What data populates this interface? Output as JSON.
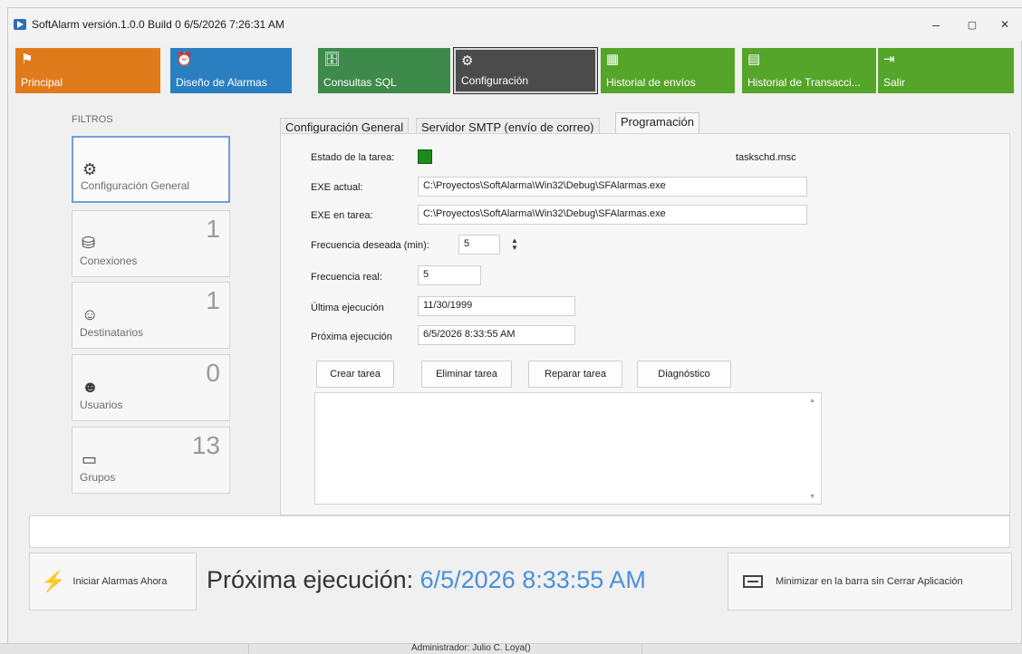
{
  "window": {
    "title": "SoftAlarm  versión.1.0.0 Build 0 6/5/2026 7:26:31 AM",
    "minimize": "–",
    "maximize": "▢",
    "close": "✕"
  },
  "ribbon": {
    "tiles": [
      {
        "label": "Principal",
        "icon": "flag-icon",
        "color": "#e07b1c"
      },
      {
        "label": "Diseño de Alarmas",
        "icon": "alarm-clock-icon",
        "color": "#2a7fc0"
      },
      {
        "label": "Consultas SQL",
        "icon": "database-icon",
        "color": "#3d8a4a"
      },
      {
        "label": "Configuración",
        "icon": "gear-icon",
        "color": "#4b4b4b"
      },
      {
        "label": "Historial de envíos",
        "icon": "calendar-icon",
        "color": "#54a52a"
      },
      {
        "label": "Historial de Transacci...",
        "icon": "server-icon",
        "color": "#54a52a"
      },
      {
        "label": "Salir",
        "icon": "exit-icon",
        "color": "#54a52a"
      }
    ]
  },
  "filters": {
    "heading": "FILTROS",
    "cards": [
      {
        "label": "Configuración General",
        "count": "",
        "icon": "gear-icon"
      },
      {
        "label": "Conexiones",
        "count": "1",
        "icon": "connection-icon"
      },
      {
        "label": "Destinatarios",
        "count": "1",
        "icon": "user-gear-icon"
      },
      {
        "label": "Usuarios",
        "count": "0",
        "icon": "users-icon"
      },
      {
        "label": "Grupos",
        "count": "13",
        "icon": "group-folder-icon"
      }
    ]
  },
  "tabs": [
    "Configuración General",
    "Servidor SMTP (envío de correo)",
    "Programación"
  ],
  "programacion": {
    "estado_label": "Estado de la tarea:",
    "estado_color": "#1c8a1c",
    "taskschd": "taskschd.msc",
    "exe_actual_label": "EXE actual:",
    "exe_actual": "C:\\Proyectos\\SoftAlarma\\Win32\\Debug\\SFAlarmas.exe",
    "exe_tarea_label": "EXE en tarea:",
    "exe_tarea": "C:\\Proyectos\\SoftAlarma\\Win32\\Debug\\SFAlarmas.exe",
    "freq_deseada_label": "Frecuencia deseada (min):",
    "freq_deseada": "5",
    "freq_real_label": "Frecuencia real:",
    "freq_real": "5",
    "ultima_label": "Última ejecución",
    "ultima": "11/30/1999",
    "proxima_label": "Próxima ejecución",
    "proxima": "6/5/2026 8:33:55 AM",
    "buttons": {
      "crear": "Crear tarea",
      "eliminar": "Eliminar tarea",
      "reparar": "Reparar tarea",
      "diagnostico": "Diagnóstico"
    }
  },
  "footer": {
    "iniciar_label": "Iniciar Alarmas Ahora",
    "next_label": "Próxima ejecución: ",
    "next_value": "6/5/2026 8:33:55 AM",
    "minimizar_label": "Minimizar en la barra sin Cerrar Aplicación",
    "status_user": "Administrador: Julio C. Loya()"
  }
}
